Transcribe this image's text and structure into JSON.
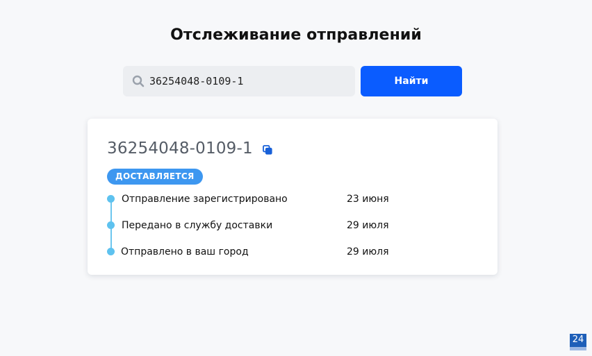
{
  "page": {
    "title": "Отслеживание отправлений"
  },
  "search": {
    "value": "36254048-0109-1",
    "icon": "search-icon",
    "button_label": "Найти",
    "button_color": "#0a5cff"
  },
  "shipment": {
    "number": "36254048-0109-1",
    "status": "ДОСТАВЛЯЕТСЯ",
    "status_color": "#3d97f0",
    "events": [
      {
        "label": "Отправление зарегистрировано",
        "date": "23 июня"
      },
      {
        "label": "Передано в службу доставки",
        "date": "29 июля"
      },
      {
        "label": "Отправлено в ваш город",
        "date": "29 июля"
      }
    ]
  },
  "corner_badge": {
    "text": "24"
  }
}
